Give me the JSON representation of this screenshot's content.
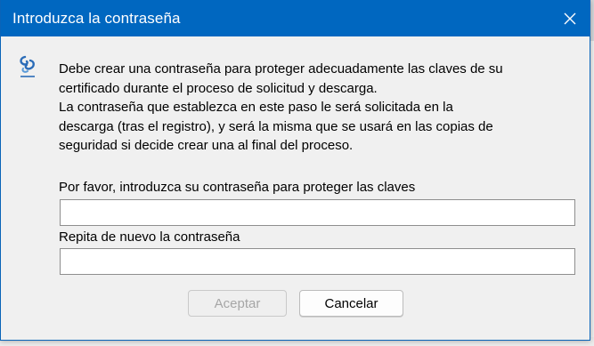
{
  "window": {
    "title": "Introduzca la contraseña"
  },
  "message": {
    "lines": [
      "Debe crear una contraseña para proteger adecuadamente las claves de su",
      "certificado durante el proceso de solicitud y descarga.",
      "La contraseña que establezca en este paso le será solicitada en la",
      "descarga (tras el registro), y será la misma que se usará en las copias de",
      "seguridad si decide crear una al final del proceso."
    ]
  },
  "form": {
    "password_label": "Por favor, introduzca su contraseña para proteger las claves",
    "password_value": "",
    "repeat_label": "Repita de nuevo la contraseña",
    "repeat_value": ""
  },
  "buttons": {
    "accept_label": "Aceptar",
    "accept_enabled": false,
    "cancel_label": "Cancelar"
  },
  "colors": {
    "titlebar": "#0067c0",
    "dialog_background": "#f0f0f0",
    "disabled_text": "#a6a6a6"
  },
  "icons": {
    "app": "ceres-logo-icon",
    "close": "close-icon"
  }
}
